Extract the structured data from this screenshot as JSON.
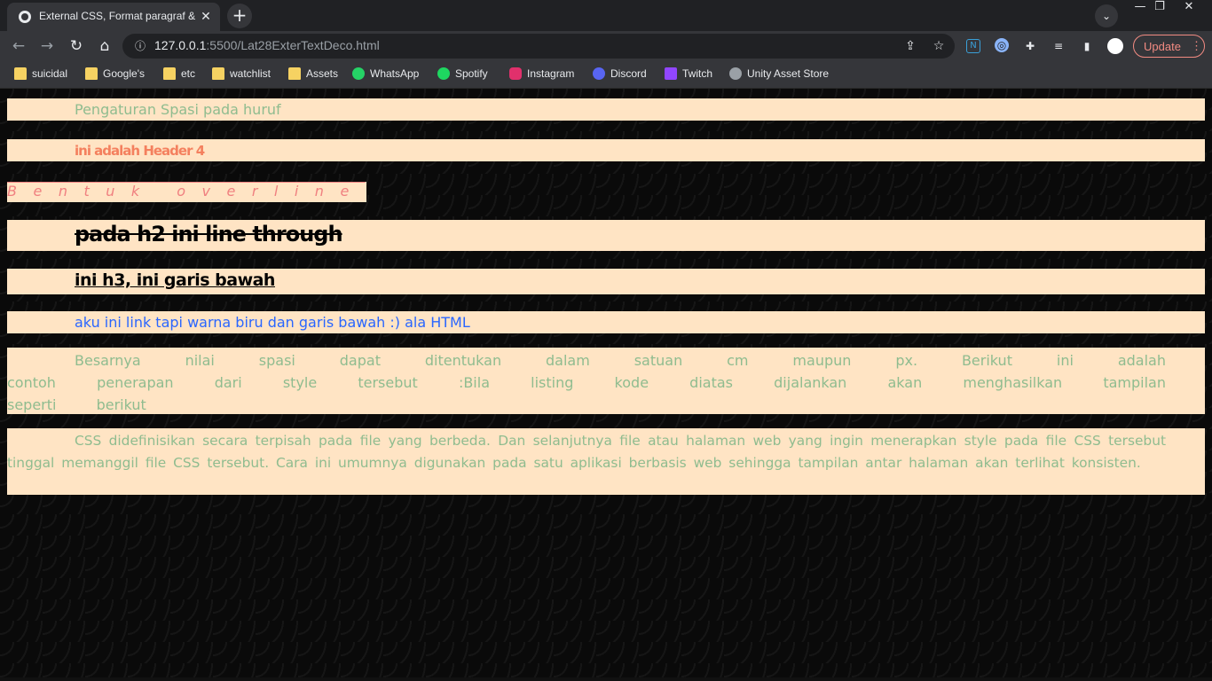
{
  "browser": {
    "tab": {
      "title": "External CSS, Format paragraf &",
      "close": "✕"
    },
    "new_tab": "+",
    "tab_search": "⌄",
    "window_controls": {
      "minimize": "—",
      "restore": "❐",
      "close": "✕"
    },
    "nav": {
      "back": "←",
      "forward": "→",
      "reload": "↻",
      "home": "⌂"
    },
    "address": {
      "host": "127.0.0.1",
      "path": ":5500/Lat28ExterTextDeco.html"
    },
    "update_label": "Update",
    "update_menu": "⋮",
    "bookmarks": [
      {
        "label": "suicidal",
        "icon": "folder-icon"
      },
      {
        "label": "Google's",
        "icon": "folder-icon"
      },
      {
        "label": "etc",
        "icon": "folder-icon"
      },
      {
        "label": "watchlist",
        "icon": "folder-icon"
      },
      {
        "label": "Assets",
        "icon": "folder-icon"
      },
      {
        "label": "WhatsApp",
        "icon": "whatsapp-icon",
        "color": "#25d366"
      },
      {
        "label": "Spotify",
        "icon": "spotify-icon",
        "color": "#1ed760"
      },
      {
        "label": "Instagram",
        "icon": "instagram-icon",
        "color": "#e1306c"
      },
      {
        "label": "Discord",
        "icon": "discord-icon",
        "color": "#5865f2"
      },
      {
        "label": "Twitch",
        "icon": "twitch-icon",
        "color": "#9146ff"
      },
      {
        "label": "Unity Asset Store",
        "icon": "unity-icon",
        "color": "#9aa0a6"
      }
    ]
  },
  "content": {
    "spacing_text": "Pengaturan Spasi pada huruf",
    "header4": "ini adalah Header 4",
    "overline": "Bentuk overline",
    "h2_strike": "pada h2 ini line through",
    "h3_underline": "ini h3, ini garis bawah",
    "link_text": "aku ini link tapi warna biru dan garis bawah :) ala HTML",
    "para1": "Besarnya nilai spasi dapat ditentukan dalam satuan cm maupun px. Berikut ini adalah contoh penerapan dari style tersebut :Bila listing kode diatas dijalankan akan menghasilkan tampilan seperti berikut",
    "para2": "CSS didefinisikan secara terpisah pada file yang berbeda. Dan selanjutnya file atau halaman web yang ingin menerapkan style pada file CSS tersebut tinggal memanggil file CSS tersebut. Cara ini umumnya digunakan pada satu aplikasi berbasis web sehingga tampilan antar halaman akan terlihat konsisten."
  },
  "colors": {
    "box_bg": "#ffe4c4",
    "green_text": "#8fbc8f",
    "coral_text": "#f4805e",
    "link_blue": "#2a66ff",
    "update_accent": "#f28b82"
  }
}
